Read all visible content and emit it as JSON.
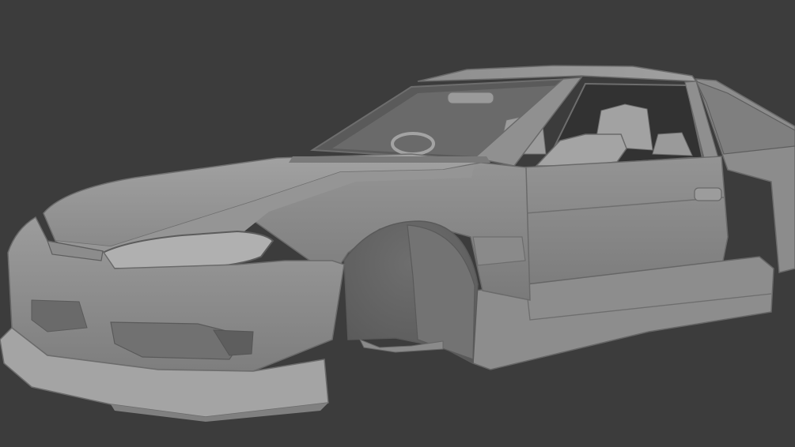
{
  "viewport": {
    "background_color": "#3c3c3c",
    "display_mode": "solid",
    "model": {
      "icon": "car-body-model",
      "body_color": "#8f8f8f",
      "shadow_color": "#5c5c5c",
      "highlight_color": "#a8a8a8",
      "interior_color": "#2a2a2a",
      "parts": [
        "hood",
        "front-bumper",
        "front-lip-spoiler",
        "left-headlight",
        "front-fender",
        "wheel-arch",
        "windshield",
        "a-pillar",
        "roof",
        "driver-door",
        "door-handle",
        "side-mirror",
        "side-skirt",
        "rear-quarter-panel",
        "front-seat",
        "steering-wheel",
        "rearview-mirror"
      ]
    }
  }
}
